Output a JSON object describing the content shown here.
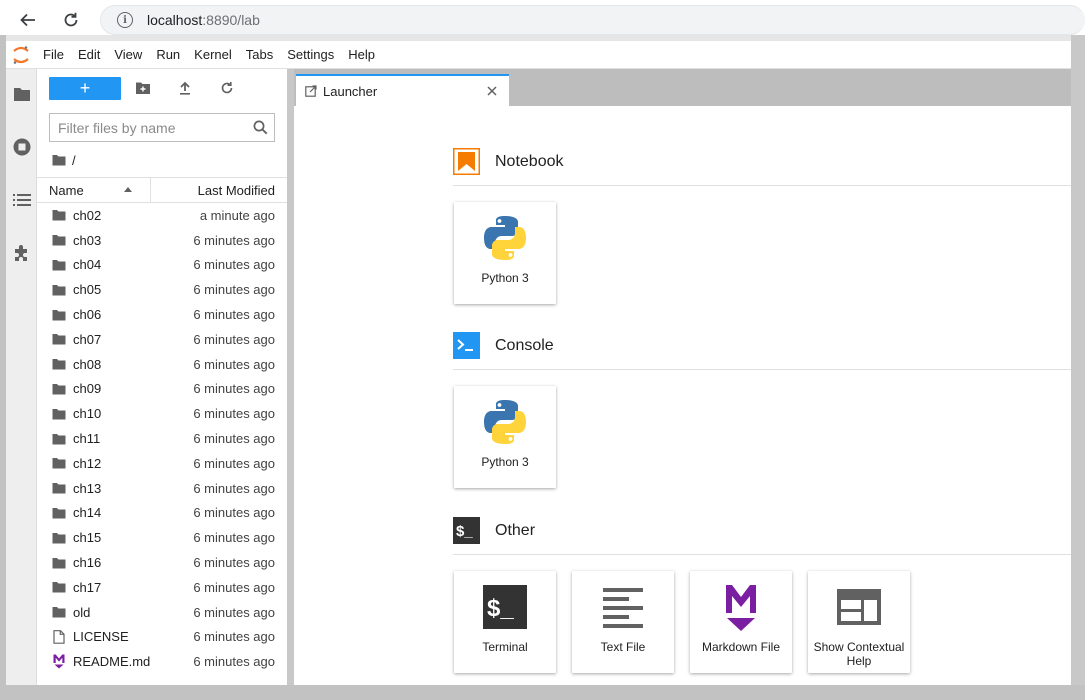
{
  "browser": {
    "url_host": "localhost",
    "url_path": ":8890/lab"
  },
  "menu": [
    "File",
    "Edit",
    "View",
    "Run",
    "Kernel",
    "Tabs",
    "Settings",
    "Help"
  ],
  "filebrowser": {
    "new_label": "+",
    "filter_placeholder": "Filter files by name",
    "breadcrumb": "/",
    "col_name": "Name",
    "col_modified": "Last Modified",
    "files": [
      {
        "name": "ch02",
        "modified": "a minute ago",
        "type": "folder"
      },
      {
        "name": "ch03",
        "modified": "6 minutes ago",
        "type": "folder"
      },
      {
        "name": "ch04",
        "modified": "6 minutes ago",
        "type": "folder"
      },
      {
        "name": "ch05",
        "modified": "6 minutes ago",
        "type": "folder"
      },
      {
        "name": "ch06",
        "modified": "6 minutes ago",
        "type": "folder"
      },
      {
        "name": "ch07",
        "modified": "6 minutes ago",
        "type": "folder"
      },
      {
        "name": "ch08",
        "modified": "6 minutes ago",
        "type": "folder"
      },
      {
        "name": "ch09",
        "modified": "6 minutes ago",
        "type": "folder"
      },
      {
        "name": "ch10",
        "modified": "6 minutes ago",
        "type": "folder"
      },
      {
        "name": "ch11",
        "modified": "6 minutes ago",
        "type": "folder"
      },
      {
        "name": "ch12",
        "modified": "6 minutes ago",
        "type": "folder"
      },
      {
        "name": "ch13",
        "modified": "6 minutes ago",
        "type": "folder"
      },
      {
        "name": "ch14",
        "modified": "6 minutes ago",
        "type": "folder"
      },
      {
        "name": "ch15",
        "modified": "6 minutes ago",
        "type": "folder"
      },
      {
        "name": "ch16",
        "modified": "6 minutes ago",
        "type": "folder"
      },
      {
        "name": "ch17",
        "modified": "6 minutes ago",
        "type": "folder"
      },
      {
        "name": "old",
        "modified": "6 minutes ago",
        "type": "folder"
      },
      {
        "name": "LICENSE",
        "modified": "6 minutes ago",
        "type": "file"
      },
      {
        "name": "README.md",
        "modified": "6 minutes ago",
        "type": "markdown"
      }
    ]
  },
  "tab": {
    "label": "Launcher"
  },
  "launcher": {
    "sections": {
      "notebook": {
        "title": "Notebook",
        "cards": [
          {
            "label": "Python 3",
            "icon": "python-logo-icon"
          }
        ]
      },
      "console": {
        "title": "Console",
        "cards": [
          {
            "label": "Python 3",
            "icon": "python-logo-icon"
          }
        ]
      },
      "other": {
        "title": "Other",
        "cards": [
          {
            "label": "Terminal",
            "icon": "terminal-icon"
          },
          {
            "label": "Text File",
            "icon": "text-file-icon"
          },
          {
            "label": "Markdown File",
            "icon": "markdown-icon"
          },
          {
            "label": "Show Contextual Help",
            "icon": "contextual-help-icon"
          }
        ]
      }
    }
  },
  "colors": {
    "accent": "#2196f3",
    "notebook_orange": "#f57c00",
    "markdown_purple": "#7b1fa2"
  }
}
